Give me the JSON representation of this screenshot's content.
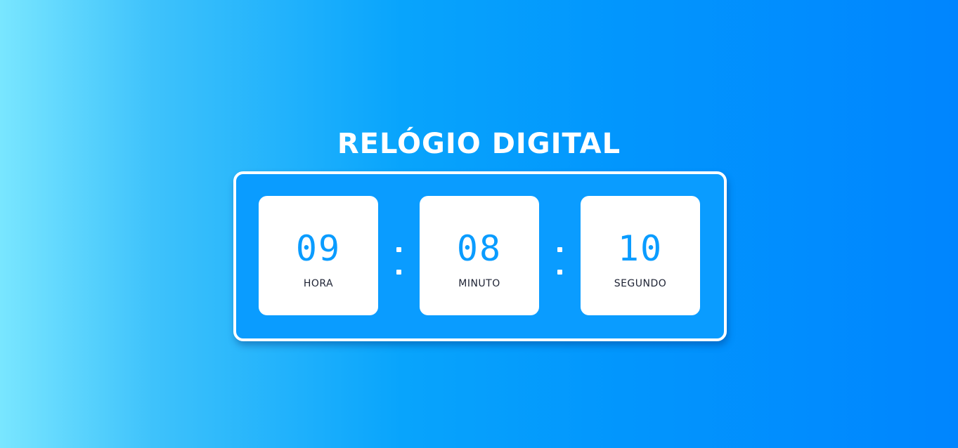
{
  "title": "RELÓGIO DIGITAL",
  "clock": {
    "hours": {
      "value": "09",
      "label": "HORA"
    },
    "minutes": {
      "value": "08",
      "label": "MINUTO"
    },
    "seconds": {
      "value": "10",
      "label": "SEGUNDO"
    }
  },
  "colors": {
    "accent": "#0a9cff",
    "card": "#ffffff",
    "label_text": "#1d2233"
  }
}
